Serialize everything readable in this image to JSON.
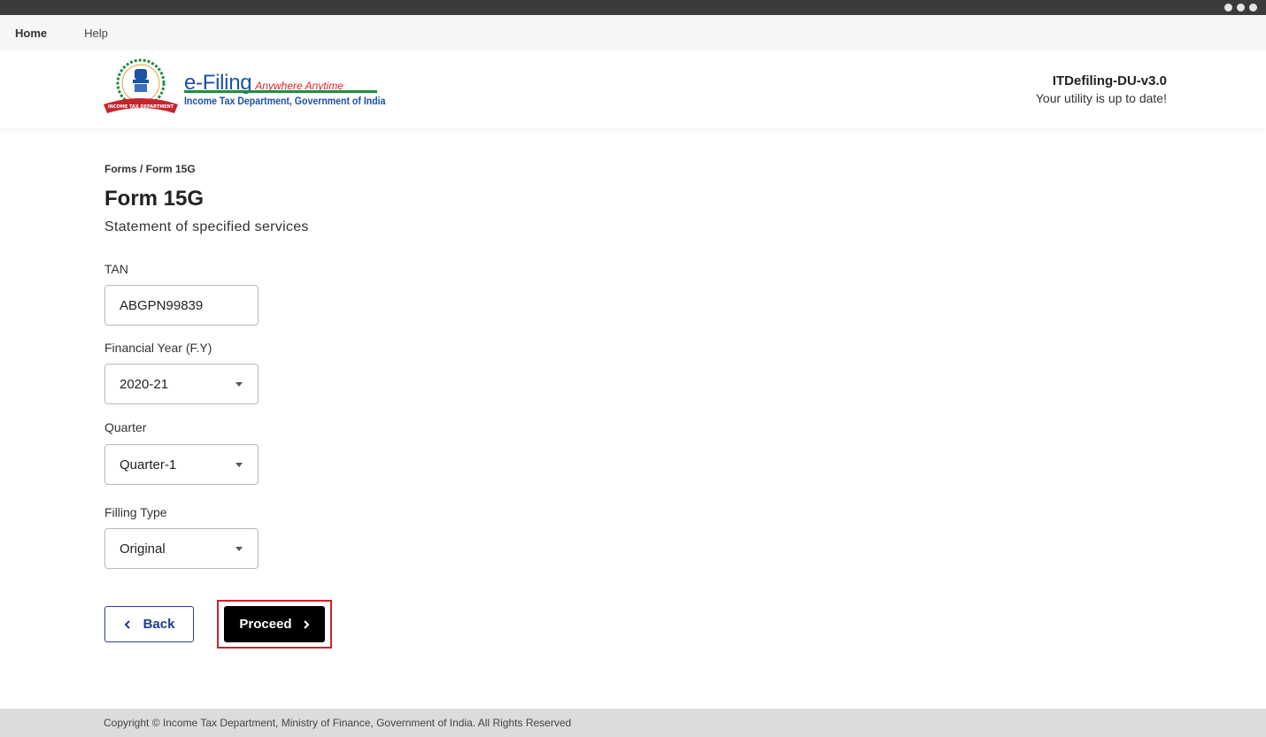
{
  "menu": {
    "home": "Home",
    "help": "Help"
  },
  "header": {
    "logo_main": "e-Filing",
    "logo_tagline": "Anywhere Anytime",
    "logo_subtitle": "Income Tax Department, Government of India",
    "emblem_ribbon": "INCOME TAX DEPARTMENT",
    "version_name": "ITDefiling-DU-v3.0",
    "version_status": "Your utility is up to date!"
  },
  "page": {
    "breadcrumb": "Forms / Form 15G",
    "title": "Form 15G",
    "subtitle": "Statement of specified services"
  },
  "form": {
    "tan_label": "TAN",
    "tan_value": "ABGPN99839",
    "fy_label": "Financial Year (F.Y)",
    "fy_value": "2020-21",
    "quarter_label": "Quarter",
    "quarter_value": "Quarter-1",
    "filing_type_label": "Filling Type",
    "filing_type_value": "Original"
  },
  "actions": {
    "back_label": "Back",
    "proceed_label": "Proceed"
  },
  "footer": {
    "copyright": "Copyright © Income Tax Department, Ministry of Finance, Government of India. All Rights Reserved"
  },
  "colors": {
    "accent_blue": "#1f3a93",
    "highlight_red": "#c8242f",
    "logo_green": "#1e8f3c"
  }
}
